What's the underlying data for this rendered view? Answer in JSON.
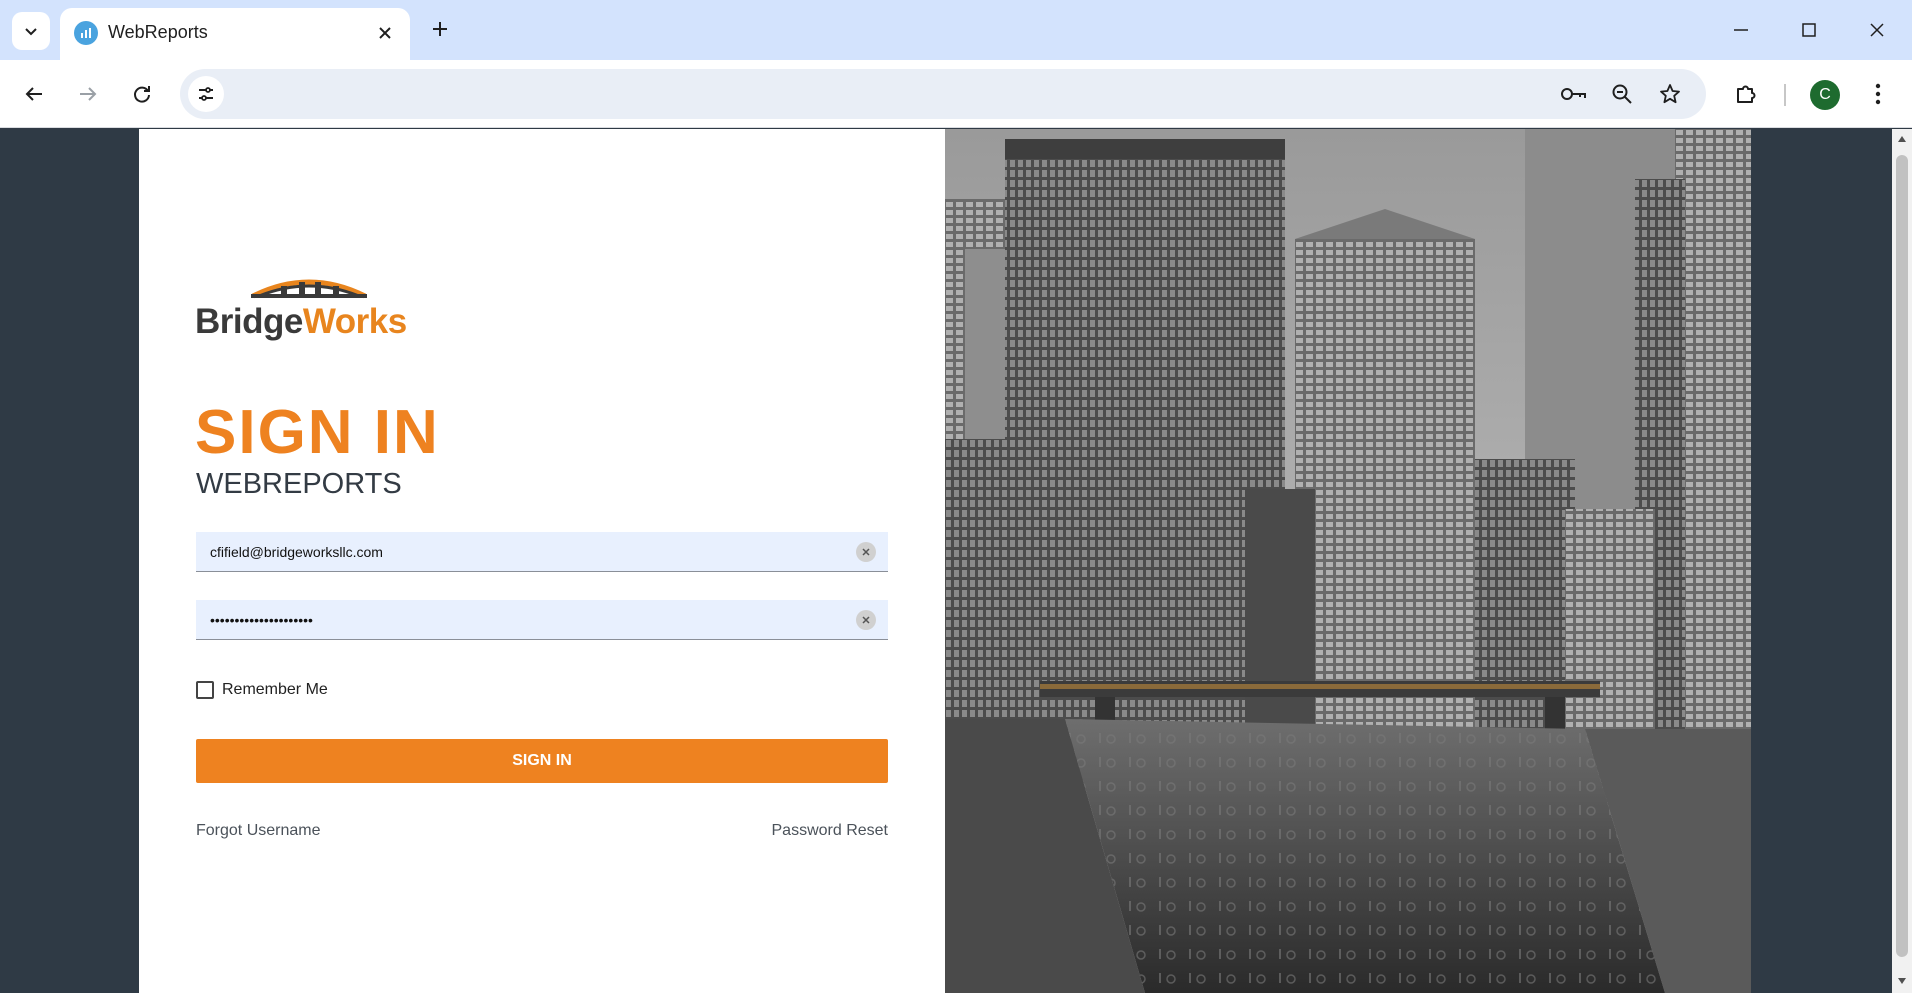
{
  "browser": {
    "tab_title": "WebReports",
    "url": "",
    "avatar_initial": "C",
    "tab_search_icon": "chevron-down-icon",
    "favicon_icon": "chart-icon"
  },
  "logo": {
    "part1": "Bridge",
    "part2": "Works"
  },
  "login": {
    "title": "SIGN IN",
    "subtitle": "WEBREPORTS",
    "username_value": "cfifield@bridgeworksllc.com",
    "password_value": "•••••••••••••••••••••",
    "remember_label": "Remember Me",
    "remember_checked": false,
    "submit_label": "SIGN IN",
    "forgot_username": "Forgot Username",
    "password_reset": "Password Reset"
  },
  "colors": {
    "accent": "#ee8220",
    "tabstrip": "#d3e3fd",
    "page_bg": "#2f3a45",
    "field_bg": "#e8f0fe"
  }
}
